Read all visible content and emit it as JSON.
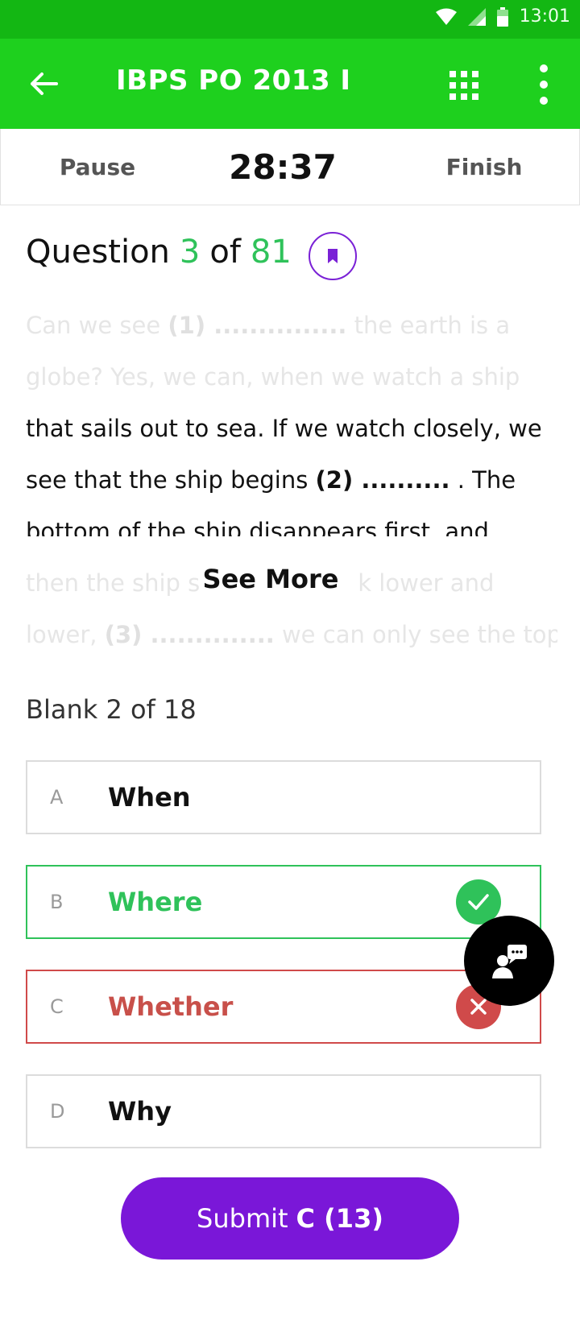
{
  "status_bar": {
    "time": "13:01"
  },
  "app_bar": {
    "title": "IBPS PO 2013 I"
  },
  "timer_bar": {
    "pause_label": "Pause",
    "timer": "28:37",
    "finish_label": "Finish"
  },
  "question": {
    "prefix": "Question",
    "number": "3",
    "of": "of",
    "total": "81"
  },
  "passage": {
    "l1_a": "Can we see ",
    "l1_b": "(1) ...............",
    "l1_c": " the earth is a",
    "l2": "globe? Yes, we can, when we watch a ship",
    "l3": "that sails out to sea. If we watch closely, we",
    "l4_a": "see that the ship begins ",
    "l4_b": "(2) ..........",
    "l4_c": " . The",
    "l5": "bottom of the ship disappears first, and",
    "l6_a": "then the ship s",
    "l6_b": "k lower and",
    "l7_a": "lower, ",
    "l7_b": "(3) ..............",
    "l7_c": " we can only see the top",
    "see_more": "See More"
  },
  "blank_label": "Blank 2 of 18",
  "options": [
    {
      "letter": "A",
      "text": "When",
      "state": "normal"
    },
    {
      "letter": "B",
      "text": "Where",
      "state": "correct"
    },
    {
      "letter": "C",
      "text": "Whether",
      "state": "wrong"
    },
    {
      "letter": "D",
      "text": "Why",
      "state": "normal"
    }
  ],
  "submit": {
    "prefix": "Submit",
    "choice": "C (13)"
  },
  "icons": {
    "back": "arrow-left-icon",
    "grid": "grid-icon",
    "more": "more-vert-icon",
    "bookmark": "bookmark-icon",
    "check": "check-icon",
    "cross": "close-icon",
    "chat": "support-chat-icon",
    "wifi": "wifi-icon",
    "signal": "signal-icon",
    "battery": "battery-icon"
  },
  "colors": {
    "status_bar": "#13b713",
    "app_bar": "#1ed01e",
    "correct": "#2fc25a",
    "wrong": "#d04a4a",
    "accent": "#7a17d8"
  }
}
